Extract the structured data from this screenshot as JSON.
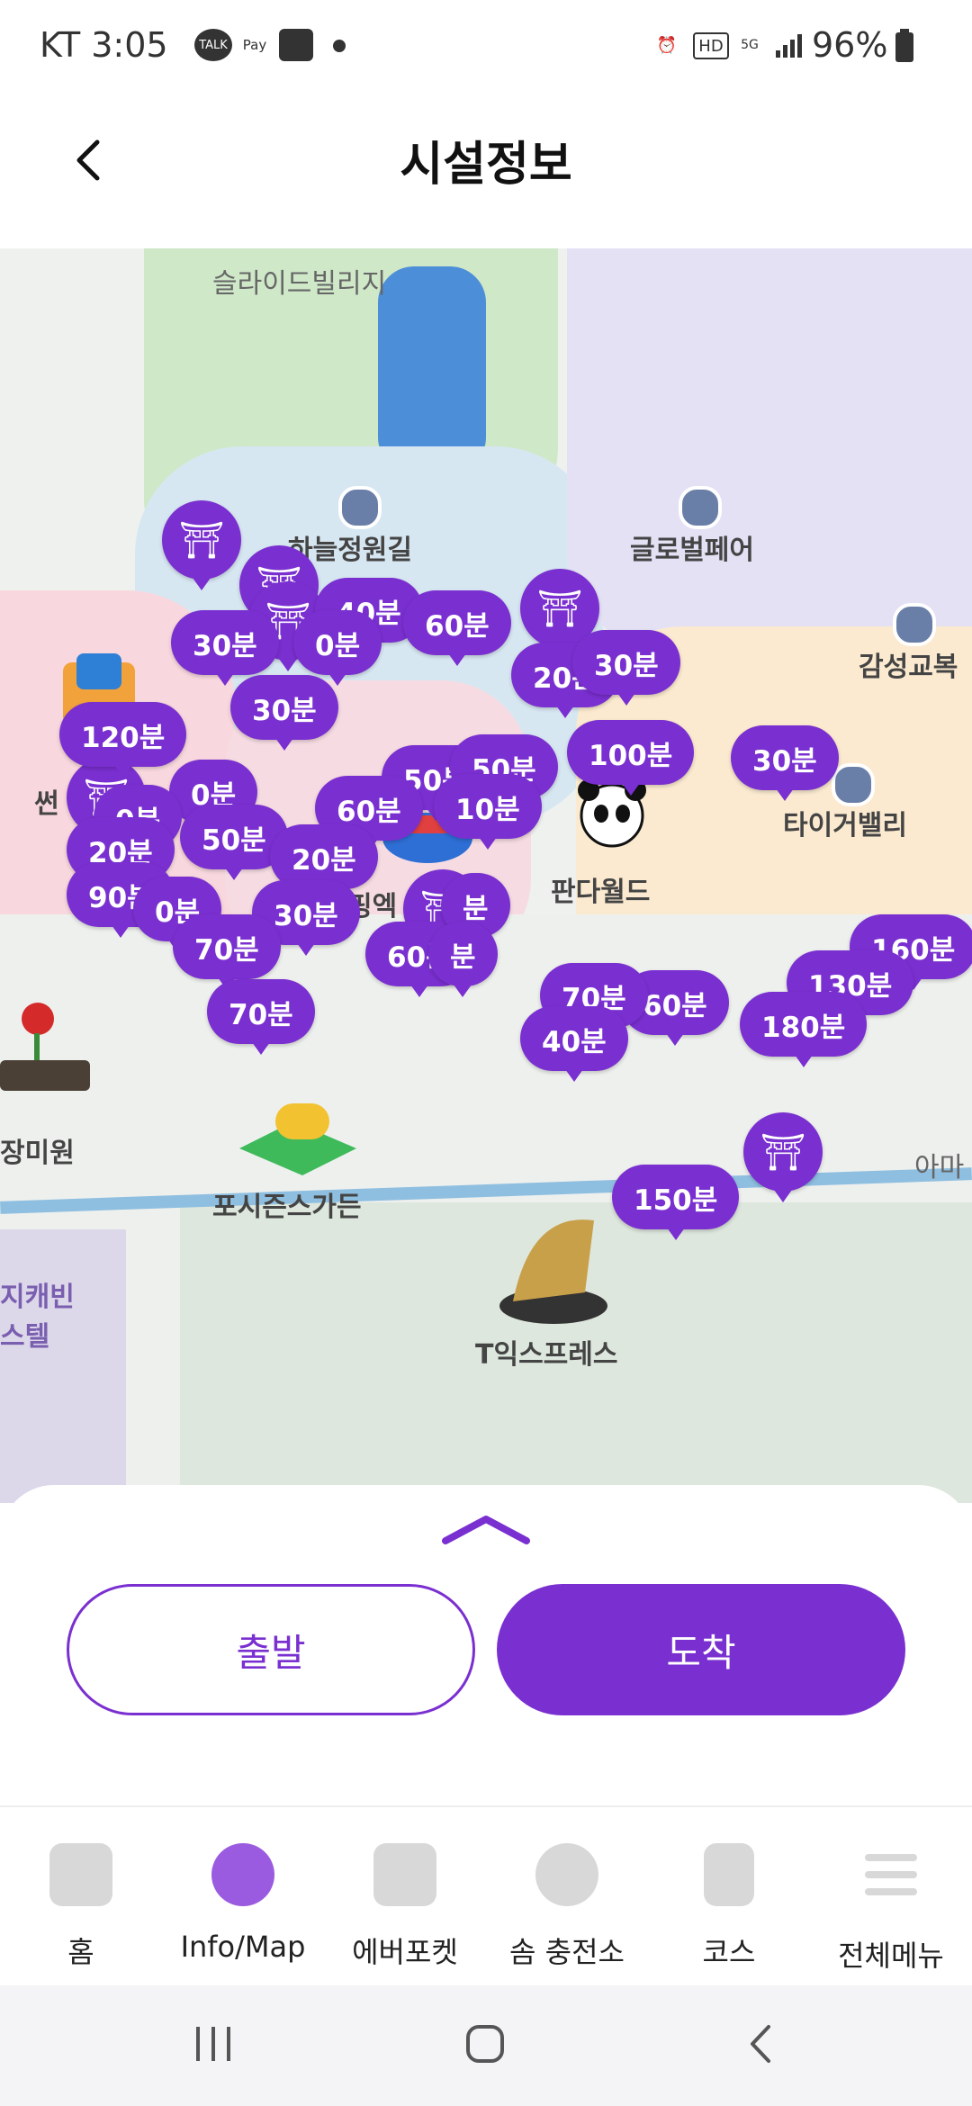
{
  "status_bar": {
    "carrier_time": "KT 3:05",
    "battery": "96%",
    "icons": [
      "talk-icon",
      "pay-icon",
      "store-icon",
      "dot-icon",
      "alarm-icon",
      "hd-icon",
      "5g-icon",
      "signal-icon",
      "battery-icon"
    ]
  },
  "header": {
    "title": "시설정보",
    "back_icon": "back-chevron-icon"
  },
  "map": {
    "places": {
      "slide_village": "슬라이드빌리지",
      "sky_garden": "하늘정원길",
      "global_fair": "글로벌페어",
      "gamseong": "감성교복",
      "tiger_valley": "타이거밸리",
      "panda_world": "판다월드",
      "rose_garden": "장미원",
      "four_seasons": "포시즌스가든",
      "t_express": "T익스프레스",
      "ama": "아마",
      "sun": "썬",
      "cabin1": "지캐빈",
      "cabin2": "스텔",
      "ping": "핑엑"
    },
    "wait_pins": [
      "30분",
      "40분",
      "60분",
      "0분",
      "30분",
      "20분",
      "30분",
      "120분",
      "100분",
      "30분",
      "0분",
      "0분",
      "50분",
      "50분",
      "50분",
      "60분",
      "10분",
      "20분",
      "20분",
      "90분",
      "30분",
      "0분",
      "70분",
      "70분",
      "60분",
      "분",
      "분",
      "60분",
      "70분",
      "40분",
      "160분",
      "130분",
      "180분",
      "150분"
    ]
  },
  "sheet": {
    "departure": "출발",
    "arrival": "도착"
  },
  "nav": {
    "items": [
      {
        "label": "홈",
        "icon": "home-icon"
      },
      {
        "label": "Info/Map",
        "icon": "map-icon"
      },
      {
        "label": "에버포켓",
        "icon": "wallet-icon"
      },
      {
        "label": "솜 충전소",
        "icon": "charge-icon"
      },
      {
        "label": "코스",
        "icon": "bookmark-icon"
      },
      {
        "label": "전체메뉴",
        "icon": "menu-icon"
      }
    ]
  },
  "system_nav": [
    "recents-icon",
    "home-circle-icon",
    "back-icon"
  ]
}
